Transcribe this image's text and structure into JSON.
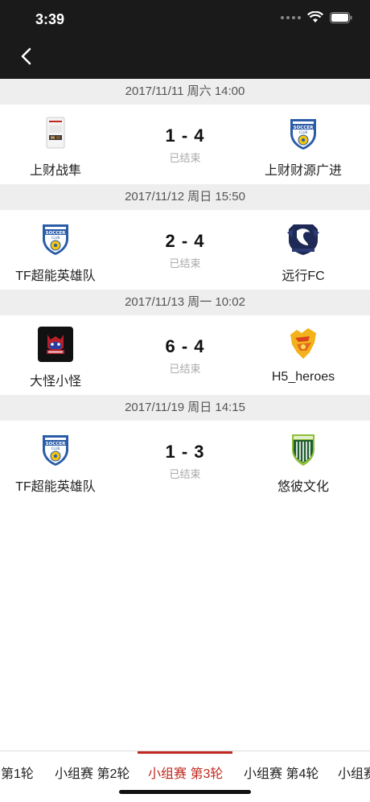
{
  "status_bar": {
    "time": "3:39"
  },
  "colors": {
    "header_bg": "#1a1a1a",
    "accent": "#c0281f",
    "date_bg": "#eeeeee",
    "status_gray": "#aaaaaa"
  },
  "matches": [
    {
      "date": "2017/11/11 周六 14:00",
      "home": "上财战隼",
      "home_logo": "photo-logo",
      "score": "1 - 4",
      "status": "已结束",
      "away": "上财财源广进",
      "away_logo": "soccer-club-shield-icon"
    },
    {
      "date": "2017/11/12 周日 15:50",
      "home": "TF超能英雄队",
      "home_logo": "soccer-club-shield-icon",
      "score": "2 - 4",
      "status": "已结束",
      "away": "远行FC",
      "away_logo": "navy-crest-icon"
    },
    {
      "date": "2017/11/13 周一 10:02",
      "home": "大怪小怪",
      "home_logo": "monster-badge-icon",
      "score": "6 - 4",
      "status": "已结束",
      "away": "H5_heroes",
      "away_logo": "yellow-emblem-icon"
    },
    {
      "date": "2017/11/19 周日 14:15",
      "home": "TF超能英雄队",
      "home_logo": "soccer-club-shield-icon",
      "score": "1 - 3",
      "status": "已结束",
      "away": "悠彼文化",
      "away_logo": "green-shield-icon"
    }
  ],
  "tabs": [
    {
      "label": "第1轮"
    },
    {
      "label": "小组赛 第2轮"
    },
    {
      "label": "小组赛 第3轮",
      "active": true
    },
    {
      "label": "小组赛 第4轮"
    },
    {
      "label": "小组赛"
    }
  ]
}
